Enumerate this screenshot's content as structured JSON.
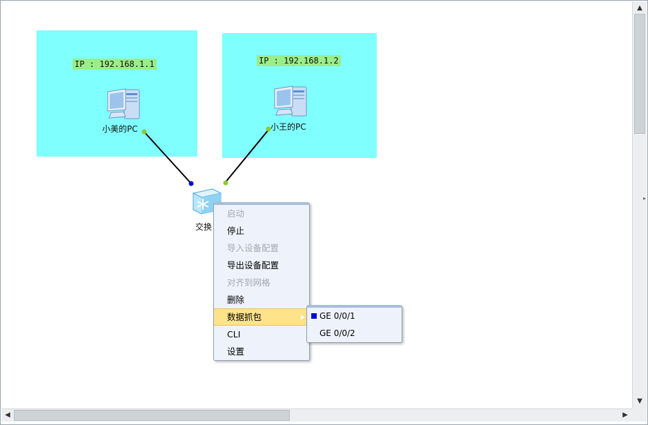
{
  "devices": {
    "pc1": {
      "label": "小美的PC",
      "ip": "IP : 192.168.1.1"
    },
    "pc2": {
      "label": "小王的PC",
      "ip": "IP : 192.168.1.2"
    },
    "switch": {
      "label": "交换"
    }
  },
  "context_menu": {
    "items": [
      {
        "label": "启动",
        "enabled": false
      },
      {
        "label": "停止",
        "enabled": true
      },
      {
        "label": "导入设备配置",
        "enabled": false
      },
      {
        "label": "导出设备配置",
        "enabled": true
      },
      {
        "label": "对齐到网格",
        "enabled": false
      },
      {
        "label": "删除",
        "enabled": true
      },
      {
        "label": "数据抓包",
        "enabled": true,
        "highlighted": true,
        "has_submenu": true
      },
      {
        "label": "CLI",
        "enabled": true
      },
      {
        "label": "设置",
        "enabled": true
      }
    ]
  },
  "capture_submenu": {
    "items": [
      {
        "label": "GE 0/0/1",
        "marked": true
      },
      {
        "label": "GE 0/0/2",
        "marked": false
      }
    ]
  },
  "scrollbars": {
    "up_arrow": "▲",
    "down_arrow": "▼",
    "left_arrow": "◀",
    "right_arrow": "▶"
  },
  "colors": {
    "pc_area": "#80ffff",
    "ip_tag": "#99ee88",
    "menu_highlight": "#ffe38a",
    "port_up": "#88cc33",
    "port_selected": "#0000dd"
  }
}
